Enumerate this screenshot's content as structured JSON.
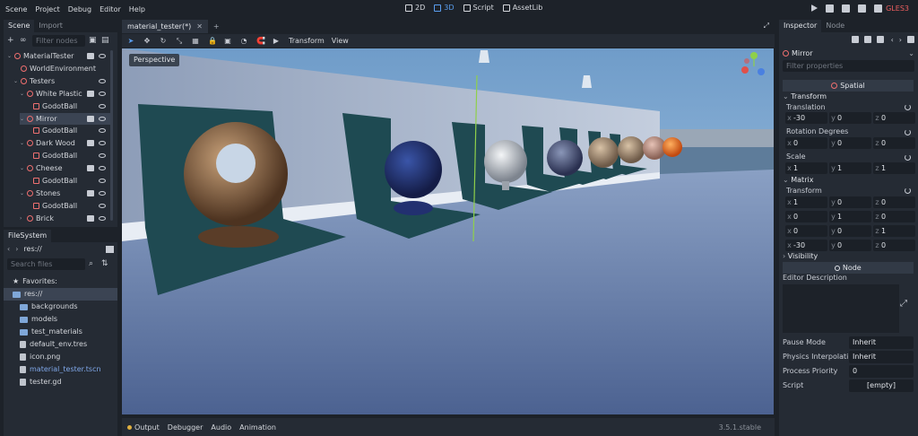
{
  "menu": [
    "Scene",
    "Project",
    "Debug",
    "Editor",
    "Help"
  ],
  "modes": [
    {
      "label": "2D",
      "active": false
    },
    {
      "label": "3D",
      "active": true
    },
    {
      "label": "Script",
      "active": false
    },
    {
      "label": "AssetLib",
      "active": false
    }
  ],
  "renderer": "GLES3",
  "scene_dock": {
    "tabs": [
      "Scene",
      "Import"
    ],
    "filter_placeholder": "Filter nodes",
    "tree": [
      {
        "label": "MaterialTester",
        "indent": 0,
        "type": "spatial",
        "arrow": "v",
        "script": true,
        "visible": true,
        "selected": false
      },
      {
        "label": "WorldEnvironment",
        "indent": 1,
        "type": "spatial",
        "arrow": "",
        "script": false,
        "visible": false,
        "selected": false
      },
      {
        "label": "Testers",
        "indent": 1,
        "type": "spatial",
        "arrow": "v",
        "script": false,
        "visible": true,
        "selected": false
      },
      {
        "label": "White Plastic",
        "indent": 2,
        "type": "spatial",
        "arrow": "v",
        "script": true,
        "visible": true,
        "selected": false
      },
      {
        "label": "GodotBall",
        "indent": 3,
        "type": "mesh",
        "arrow": "",
        "script": false,
        "visible": true,
        "selected": false
      },
      {
        "label": "Mirror",
        "indent": 2,
        "type": "spatial",
        "arrow": "v",
        "script": true,
        "visible": true,
        "selected": true
      },
      {
        "label": "GodotBall",
        "indent": 3,
        "type": "mesh",
        "arrow": "",
        "script": false,
        "visible": true,
        "selected": false
      },
      {
        "label": "Dark Wood",
        "indent": 2,
        "type": "spatial",
        "arrow": "v",
        "script": true,
        "visible": true,
        "selected": false
      },
      {
        "label": "GodotBall",
        "indent": 3,
        "type": "mesh",
        "arrow": "",
        "script": false,
        "visible": true,
        "selected": false
      },
      {
        "label": "Cheese",
        "indent": 2,
        "type": "spatial",
        "arrow": "v",
        "script": true,
        "visible": true,
        "selected": false
      },
      {
        "label": "GodotBall",
        "indent": 3,
        "type": "mesh",
        "arrow": "",
        "script": false,
        "visible": true,
        "selected": false
      },
      {
        "label": "Stones",
        "indent": 2,
        "type": "spatial",
        "arrow": "v",
        "script": true,
        "visible": true,
        "selected": false
      },
      {
        "label": "GodotBall",
        "indent": 3,
        "type": "mesh",
        "arrow": "",
        "script": false,
        "visible": true,
        "selected": false
      },
      {
        "label": "Brick",
        "indent": 2,
        "type": "spatial",
        "arrow": ">",
        "script": true,
        "visible": true,
        "selected": false
      }
    ]
  },
  "filesystem": {
    "tab": "FileSystem",
    "path": "res://",
    "search_placeholder": "Search files",
    "items": [
      {
        "label": "Favorites:",
        "kind": "star",
        "indent": 0,
        "selected": false
      },
      {
        "label": "res://",
        "kind": "folder",
        "indent": 0,
        "selected": true
      },
      {
        "label": "backgrounds",
        "kind": "folder",
        "indent": 1,
        "selected": false
      },
      {
        "label": "models",
        "kind": "folder",
        "indent": 1,
        "selected": false
      },
      {
        "label": "test_materials",
        "kind": "folder",
        "indent": 1,
        "selected": false
      },
      {
        "label": "default_env.tres",
        "kind": "file",
        "indent": 1,
        "selected": false
      },
      {
        "label": "icon.png",
        "kind": "file",
        "indent": 1,
        "selected": false
      },
      {
        "label": "material_tester.tscn",
        "kind": "file",
        "indent": 1,
        "selected": false,
        "highlight": true
      },
      {
        "label": "tester.gd",
        "kind": "file",
        "indent": 1,
        "selected": false
      }
    ]
  },
  "viewport": {
    "tab_label": "material_tester(*)",
    "toolbar_labels": [
      "Transform",
      "View"
    ],
    "perspective_label": "Perspective"
  },
  "bottom": {
    "tabs": [
      "Output",
      "Debugger",
      "Audio",
      "Animation"
    ],
    "version": "3.5.1.stable"
  },
  "inspector": {
    "tabs": [
      "Inspector",
      "Node"
    ],
    "object": "Mirror",
    "filter_placeholder": "Filter properties",
    "spatial_header": "Spatial",
    "transform_group": "Transform",
    "translation_label": "Translation",
    "translation": [
      "-30",
      "0",
      "0"
    ],
    "rotation_label": "Rotation Degrees",
    "rotation": [
      "0",
      "0",
      "0"
    ],
    "scale_label": "Scale",
    "scale": [
      "1",
      "1",
      "1"
    ],
    "matrix_group": "Matrix",
    "matrix_transform_label": "Transform",
    "matrix": [
      [
        "1",
        "0",
        "0"
      ],
      [
        "0",
        "1",
        "0"
      ],
      [
        "0",
        "0",
        "1"
      ],
      [
        "-30",
        "0",
        "0"
      ]
    ],
    "visibility_group": "Visibility",
    "node_header": "Node",
    "editor_description": "Editor Description",
    "pause_mode_label": "Pause Mode",
    "pause_mode": "Inherit",
    "physics_label": "Physics Interpolati",
    "physics": "Inherit",
    "priority_label": "Process Priority",
    "priority": "0",
    "script_label": "Script",
    "script": "[empty]"
  },
  "colors": {
    "accent": "#5a9eef",
    "node_red": "#ef6f6f",
    "bg": "#1d2229",
    "panel": "#252b34"
  }
}
